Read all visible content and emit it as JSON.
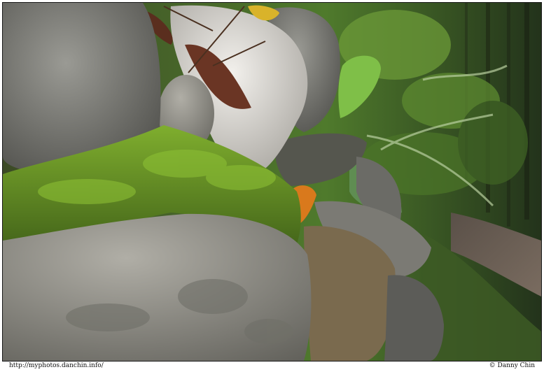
{
  "photo": {
    "subject": "moss-covered stone wall beside a forest path",
    "colors": {
      "stone": "#8a8a84",
      "moss": "#6f9a2a",
      "quartz": "#e4e2de",
      "foliage": "#4f7a2c",
      "path": "#6a5f55",
      "leaf_orange": "#d9791c"
    }
  },
  "caption": {
    "url": "http://myphotos.danchin.info/",
    "copyright": "© Danny Chin"
  }
}
